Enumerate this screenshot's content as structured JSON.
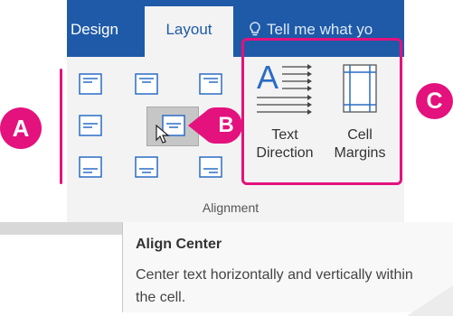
{
  "tabs": {
    "design": "Design",
    "layout": "Layout",
    "tell_me": "Tell me what yo"
  },
  "callouts": {
    "a": "A",
    "b": "B",
    "c": "C"
  },
  "buttons": {
    "text_direction": [
      "Text",
      "Direction"
    ],
    "cell_margins": [
      "Cell",
      "Margins"
    ]
  },
  "group_label": "Alignment",
  "tooltip": {
    "title": "Align Center",
    "body": "Center text horizontally and vertically within the cell."
  },
  "colors": {
    "ribbon_blue": "#1e5aa8",
    "callout_pink": "#e3127d",
    "icon_blue": "#2b6cc4"
  },
  "icons": [
    "lightbulb-icon",
    "align-top-left-icon",
    "align-top-center-icon",
    "align-top-right-icon",
    "align-center-left-icon",
    "align-center-icon",
    "align-center-right-icon",
    "align-bottom-left-icon",
    "align-bottom-center-icon",
    "align-bottom-right-icon",
    "text-direction-icon",
    "cell-margins-icon",
    "mouse-pointer-icon"
  ]
}
